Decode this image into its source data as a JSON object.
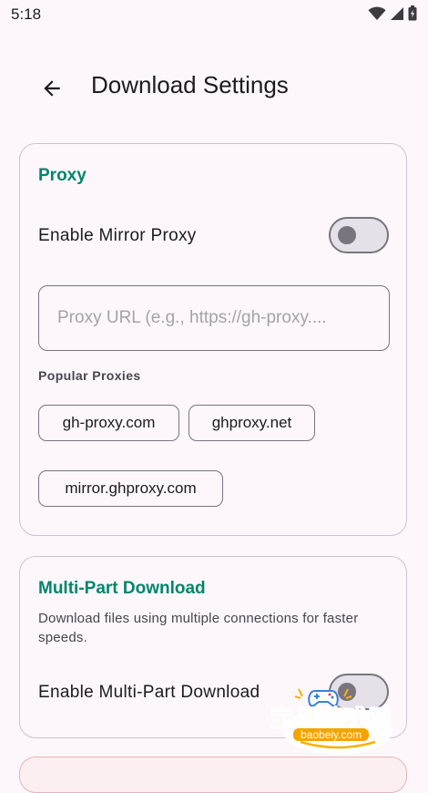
{
  "status_bar": {
    "time": "5:18",
    "icons": [
      "wifi-icon",
      "signal-icon",
      "battery-icon"
    ]
  },
  "app_bar": {
    "back_icon": "arrow-left-icon",
    "title": "Download Settings"
  },
  "proxy_section": {
    "title": "Proxy",
    "enable_label": "Enable Mirror Proxy",
    "enable_on": false,
    "url_value": "",
    "url_placeholder": "Proxy URL (e.g., https://gh-proxy....",
    "popular_label": "Popular Proxies",
    "chips": [
      "gh-proxy.com",
      "ghproxy.net",
      "mirror.ghproxy.com"
    ]
  },
  "multipart_section": {
    "title": "Multi-Part Download",
    "description": "Download files using multiple connections for faster speeds.",
    "enable_label": "Enable Multi-Part Download",
    "enable_on": false
  },
  "watermark": {
    "brand": "宝贝游戏网",
    "domain": "baobeiy.com"
  },
  "colors": {
    "background": "#fdf7fb",
    "accent": "#00866b",
    "outline": "#79747e",
    "text": "#1d1b20"
  }
}
